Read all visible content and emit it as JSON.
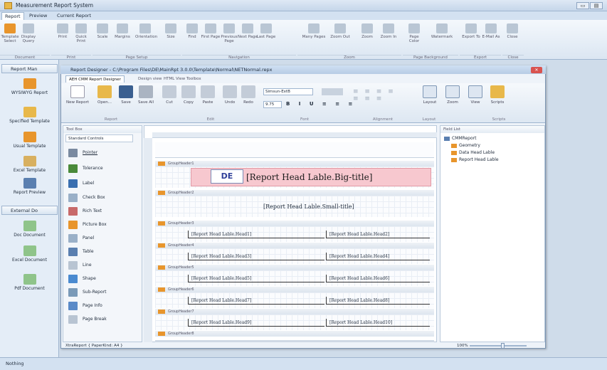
{
  "app": {
    "title": "Measurement Report System"
  },
  "main_tabs": [
    "Report",
    "Preview",
    "Current Report"
  ],
  "ribbon": {
    "buttons": [
      "Template Select",
      "Display Query",
      "Print",
      "Quick Print",
      "Scale",
      "Margins",
      "Orientation",
      "Size",
      "Find",
      "First Page",
      "Previous Page",
      "Next Page",
      "Last Page",
      "Many Pages",
      "Zoom Out",
      "Zoom",
      "Zoom In",
      "Page Color",
      "Watermark",
      "Export To",
      "E-Mail As",
      "Close"
    ],
    "groups": [
      "Document",
      "Print",
      "Page Setup",
      "Navigation",
      "Zoom",
      "Page Background",
      "Export",
      "Close"
    ]
  },
  "left": {
    "panel1": "Report Man",
    "items1": [
      "WYSIWYG Report",
      "Specified Template",
      "Usual Template",
      "Excel Template",
      "Report Preview"
    ],
    "panel2": "External Do",
    "items2": [
      "Doc Document",
      "Excel Document",
      "Pdf Document"
    ]
  },
  "designer": {
    "title": "Report Designer - C:\\Program Files\\DE\\MainRpt 3.0.0\\Template\\Normal\\NETNormal.repx",
    "tabs": [
      "AEH CMM Report Designer",
      "Design view",
      "HTML View",
      "Toolbox"
    ],
    "buttons": [
      "New Report",
      "Open...",
      "Save",
      "Save All",
      "Cut",
      "Copy",
      "Paste",
      "Undo",
      "Redo",
      "Layout",
      "Zoom",
      "View",
      "Scripts"
    ],
    "groups": [
      "Report",
      "Edit",
      "Font",
      "Alignment",
      "Layout",
      "Scripts"
    ],
    "font_name": "Simsun-ExtB",
    "font_size": "9.75",
    "status": "XtraReport { PaperKind: A4 }"
  },
  "toolbox": {
    "title": "Tool Box",
    "category": "Standard Controls",
    "items": [
      "Pointer",
      "Tolerance",
      "Label",
      "Check Box",
      "Rich Text",
      "Picture Box",
      "Panel",
      "Table",
      "Line",
      "Shape",
      "Sub-Report",
      "Page Info",
      "Page Break"
    ]
  },
  "bands": {
    "headers": [
      "GroupHeader1",
      "GroupHeader2",
      "GroupHeader3",
      "GroupHeader4",
      "GroupHeader5",
      "GroupHeader6",
      "GroupHeader7",
      "GroupHeader8"
    ],
    "big_title": "[Report Head Lable.Big-title]",
    "small_title": "[Report Head Lable.Small-title]",
    "logo_text": "DE",
    "cells": [
      [
        "[Report Head Lable.Head1]",
        "[Report Head Lable.Head2]"
      ],
      [
        "[Report Head Lable.Head3]",
        "[Report Head Lable.Head4]"
      ],
      [
        "[Report Head Lable.Head5]",
        "[Report Head Lable.Head6]"
      ],
      [
        "[Report Head Lable.Head7]",
        "[Report Head Lable.Head8]"
      ],
      [
        "[Report Head Lable.Head9]",
        "[Report Head Lable.Head10]"
      ]
    ]
  },
  "fieldlist": {
    "title": "Field List",
    "root": "CMMReport",
    "children": [
      "Geometry",
      "Data Head Lable",
      "Report Head Lable"
    ]
  },
  "zoom": "100%",
  "status": "Nothing",
  "colors": {
    "accent": "#e8952c",
    "titlebar": "#c5d6ea"
  }
}
